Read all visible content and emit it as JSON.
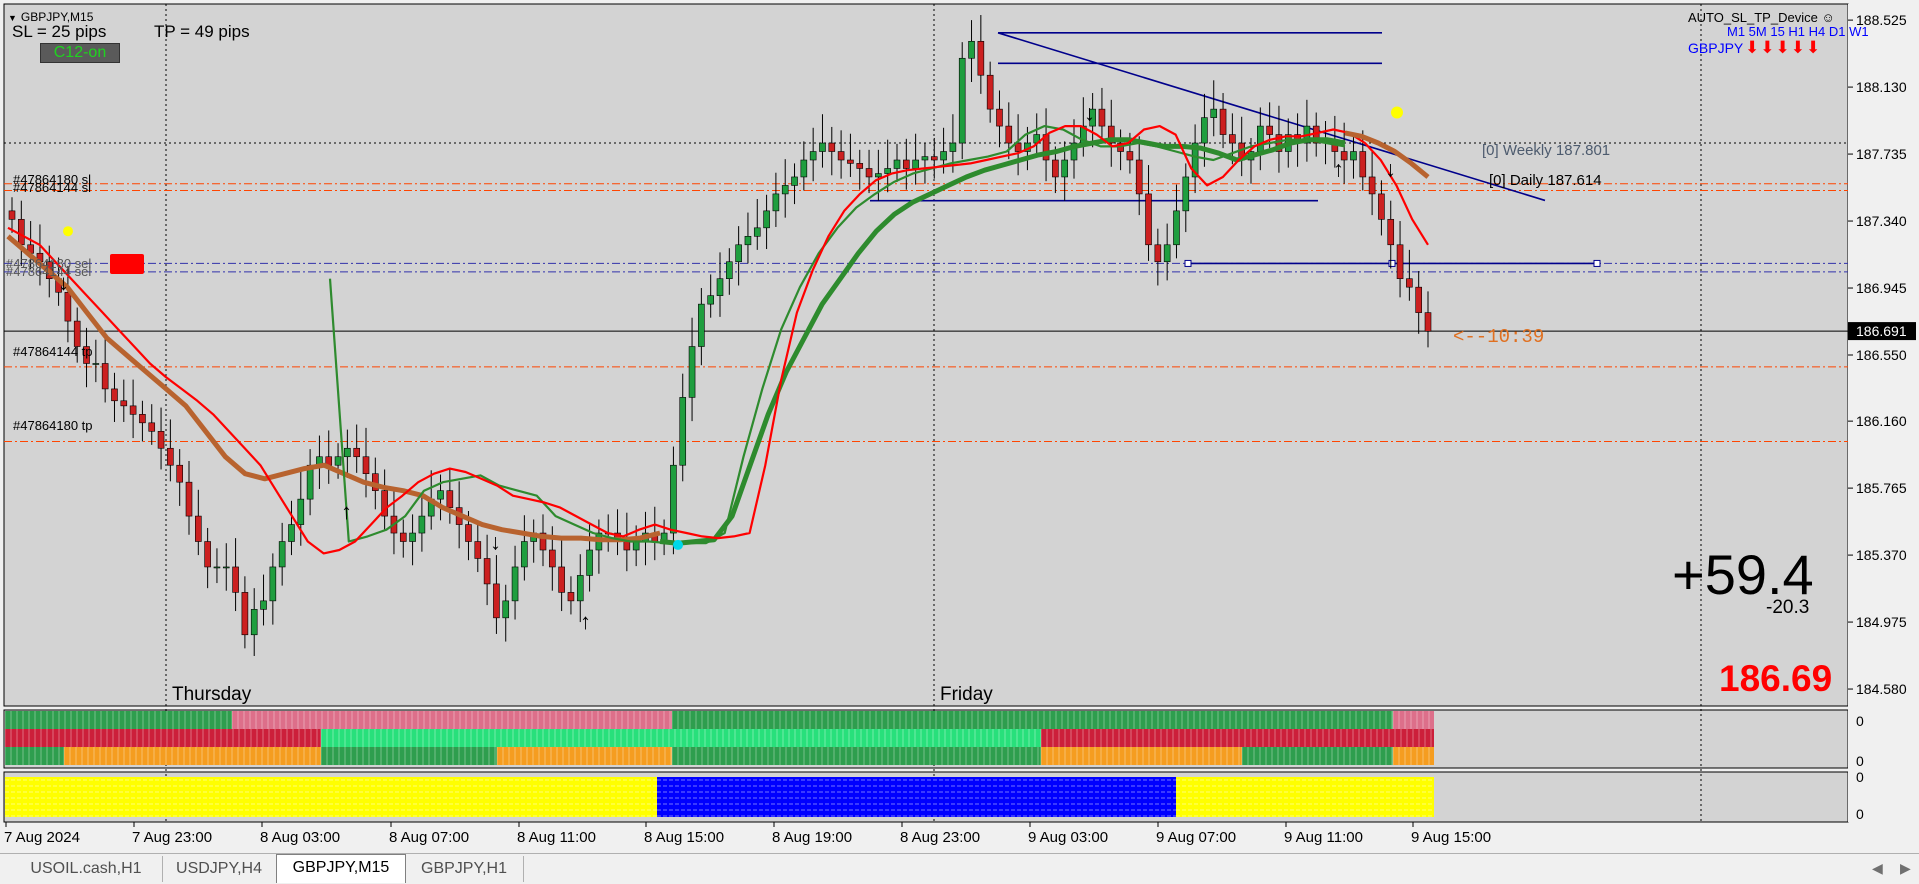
{
  "header": {
    "symbol": "GBPJPY,M15",
    "sl_text": "SL = 25 pips",
    "tp_text": "TP = 49 pips",
    "c12_badge": "C12-on",
    "device_title": "AUTO_SL_TP_Device",
    "device_symbol": "GBPJPY",
    "timeframes": "M1 5M 15 H1 H4 D1 W1",
    "timeframe_arrows": "⬇⬇⬇⬇⬇"
  },
  "labels": {
    "weekly": "[0] Weekly 187.801",
    "daily": "[0] Daily 187.614",
    "countdown": "<--10:39",
    "profit_main": "+59.4",
    "profit_sub": "-20.3",
    "current_price": "186.69",
    "order_sl1": "#47864180 sl",
    "order_sl2": "#47864144 sl",
    "order_sel1": "#47864180 sel",
    "order_sel2": "#47864144 sel",
    "order_tp1": "#47864144 tp",
    "order_tp2": "#47864180 tp",
    "day_thursday": "Thursday",
    "day_friday": "Friday"
  },
  "chart_data": {
    "type": "candlestick",
    "symbol": "GBPJPY",
    "timeframe": "M15",
    "y_ticks": [
      "188.525",
      "188.130",
      "187.735",
      "187.340",
      "186.945",
      "186.550",
      "186.160",
      "185.765",
      "185.370",
      "184.975",
      "184.580"
    ],
    "ylim": [
      184.48,
      188.62
    ],
    "current_price_label": "186.691",
    "current_price": 186.691,
    "x_ticks": [
      "7 Aug 2024",
      "7 Aug 23:00",
      "8 Aug 03:00",
      "8 Aug 07:00",
      "8 Aug 11:00",
      "8 Aug 15:00",
      "8 Aug 19:00",
      "8 Aug 23:00",
      "9 Aug 03:00",
      "9 Aug 07:00",
      "9 Aug 11:00",
      "9 Aug 15:00"
    ],
    "close_series": [
      187.35,
      187.2,
      187.15,
      187.1,
      187.0,
      186.92,
      186.75,
      186.6,
      186.5,
      186.5,
      186.35,
      186.28,
      186.25,
      186.2,
      186.15,
      186.1,
      186.0,
      185.9,
      185.8,
      185.6,
      185.45,
      185.3,
      185.3,
      185.3,
      185.15,
      184.9,
      185.05,
      185.1,
      185.3,
      185.45,
      185.55,
      185.7,
      185.9,
      185.95,
      185.9,
      185.95,
      186.0,
      185.95,
      185.85,
      185.75,
      185.6,
      185.5,
      185.45,
      185.5,
      185.6,
      185.7,
      185.75,
      185.65,
      185.55,
      185.45,
      185.35,
      185.2,
      185.0,
      185.1,
      185.3,
      185.45,
      185.5,
      185.4,
      185.3,
      185.15,
      185.1,
      185.25,
      185.4,
      185.5,
      185.5,
      185.45,
      185.4,
      185.45,
      185.5,
      185.45,
      185.5,
      185.9,
      186.3,
      186.6,
      186.85,
      186.9,
      187.0,
      187.1,
      187.2,
      187.25,
      187.3,
      187.4,
      187.5,
      187.55,
      187.6,
      187.7,
      187.75,
      187.8,
      187.75,
      187.7,
      187.68,
      187.65,
      187.6,
      187.62,
      187.65,
      187.7,
      187.65,
      187.7,
      187.72,
      187.7,
      187.75,
      187.8,
      188.3,
      188.4,
      188.2,
      188.0,
      187.9,
      187.8,
      187.75,
      187.8,
      187.85,
      187.7,
      187.6,
      187.7,
      187.8,
      187.9,
      188.0,
      187.9,
      187.8,
      187.75,
      187.7,
      187.5,
      187.2,
      187.1,
      187.2,
      187.4,
      187.6,
      187.8,
      187.95,
      188.0,
      187.85,
      187.8,
      187.7,
      187.75,
      187.9,
      187.85,
      187.75,
      187.85,
      187.8,
      187.9,
      187.8,
      187.82,
      187.75,
      187.7,
      187.75,
      187.6,
      187.5,
      187.35,
      187.2,
      187.0,
      186.95,
      186.8,
      186.69
    ],
    "ma_fast_red": [
      187.3,
      187.25,
      187.2,
      187.1,
      187.0,
      186.9,
      186.8,
      186.7,
      186.6,
      186.5,
      186.42,
      186.35,
      186.28,
      186.2,
      186.1,
      186.0,
      185.9,
      185.75,
      185.6,
      185.45,
      185.38,
      185.4,
      185.45,
      185.55,
      185.65,
      185.72,
      185.8,
      185.85,
      185.88,
      185.86,
      185.82,
      185.78,
      185.72,
      185.7,
      185.68,
      185.65,
      185.6,
      185.55,
      185.5,
      185.48,
      185.52,
      185.55,
      185.52,
      185.5,
      185.48,
      185.47,
      185.48,
      185.5,
      185.9,
      186.4,
      186.8,
      187.05,
      187.25,
      187.4,
      187.5,
      187.58,
      187.62,
      187.64,
      187.65,
      187.66,
      187.67,
      187.68,
      187.7,
      187.72,
      187.74,
      187.78,
      187.86,
      187.9,
      187.9,
      187.85,
      187.78,
      187.8,
      187.88,
      187.9,
      187.85,
      187.65,
      187.55,
      187.6,
      187.7,
      187.78,
      187.82,
      187.84,
      187.84,
      187.86,
      187.88,
      187.86,
      187.8,
      187.7,
      187.55,
      187.35,
      187.2
    ],
    "ma_green": [
      187.0,
      185.45,
      185.48,
      185.52,
      185.6,
      185.75,
      185.8,
      185.82,
      185.84,
      185.78,
      185.75,
      185.72,
      185.6,
      185.55,
      185.5,
      185.47,
      185.45,
      185.45,
      185.44,
      185.44,
      185.44,
      185.5,
      185.95,
      186.35,
      186.7,
      186.95,
      187.15,
      187.3,
      187.42,
      187.5,
      187.57,
      187.62,
      187.65,
      187.68,
      187.7,
      187.72,
      187.75,
      187.85,
      187.9,
      187.88,
      187.82,
      187.78,
      187.78,
      187.8,
      187.78,
      187.75,
      187.72,
      187.7,
      187.74,
      187.78,
      187.8,
      187.82,
      187.82,
      187.8,
      187.78
    ],
    "ma_thick_green": [
      185.45,
      185.44,
      185.45,
      185.46,
      185.6,
      185.9,
      186.2,
      186.45,
      186.65,
      186.85,
      187.0,
      187.15,
      187.28,
      187.38,
      187.45,
      187.5,
      187.55,
      187.6,
      187.64,
      187.67,
      187.7,
      187.73,
      187.75,
      187.78,
      187.8,
      187.82,
      187.82,
      187.8,
      187.78,
      187.78,
      187.77,
      187.74,
      187.7,
      187.73,
      187.76,
      187.8,
      187.82,
      187.82,
      187.8
    ],
    "ma_thick_brown": [
      187.25,
      187.15,
      187.05,
      186.95,
      186.8,
      186.65,
      186.55,
      186.45,
      186.35,
      186.25,
      186.1,
      185.95,
      185.85,
      185.82,
      185.85,
      185.88,
      185.9,
      185.85,
      185.8,
      185.77,
      185.75,
      185.72,
      185.65,
      185.6,
      185.55,
      185.52,
      185.5,
      185.48,
      185.47,
      185.47,
      185.46,
      185.46,
      185.47,
      185.5
    ],
    "ma_brown_right": [
      187.86,
      187.84,
      187.8,
      187.75,
      187.68,
      187.6
    ],
    "order_lines": {
      "sl_price": 187.56,
      "sel1_price": 187.09,
      "sel2_price": 187.04,
      "tp1_price": 186.48,
      "tp2_price": 186.04
    },
    "trend_lines": {
      "top_high": 188.45,
      "mid_line": 188.27,
      "support": 187.46,
      "lower_box": 187.09,
      "trend_start": 188.45,
      "trend_end": 187.55
    },
    "indicator_panel_1": {
      "rows": 4,
      "row_colors_segments": [
        [
          "#2e9e4e",
          "#dd6f8a",
          "#2e9e4e",
          "#dd6f8a"
        ],
        [
          "#cc1f3a",
          "#28e07b",
          "#cc1f3a"
        ],
        [
          "#f59d20",
          "#2e9e4e",
          "#f59d20",
          "#2e9e4e",
          "#f59d20"
        ],
        [
          "#2e9e4e",
          "#2e9e4e"
        ]
      ],
      "y_ticks": [
        "0",
        "0"
      ]
    },
    "indicator_panel_2": {
      "rows": 1,
      "colors": [
        "#ffff00",
        "#0000ff",
        "#ffff00"
      ],
      "y_ticks": [
        "0",
        "0"
      ]
    }
  },
  "tabs": [
    {
      "label": "USOIL.cash,H1",
      "active": false
    },
    {
      "label": "USDJPY,H4",
      "active": false
    },
    {
      "label": "GBPJPY,M15",
      "active": true
    },
    {
      "label": "GBPJPY,H1",
      "active": false
    }
  ],
  "colors": {
    "chart_bg": "#d3d3d3",
    "bull": "#1f9e3f",
    "bear": "#cc2020",
    "ma_red": "#ff0000",
    "ma_green": "#2e8b2e",
    "ma_brown": "#b8632f",
    "trend_blue": "#00008b",
    "order_red": "#ff4500"
  }
}
